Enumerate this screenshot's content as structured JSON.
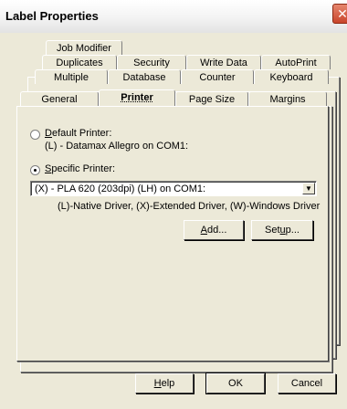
{
  "window": {
    "title": "Label Properties",
    "close_glyph": "✕"
  },
  "tabs": {
    "row1": [
      "Job Modifier"
    ],
    "row2": [
      "Duplicates",
      "Security",
      "Write Data",
      "AutoPrint"
    ],
    "row3": [
      "Multiple",
      "Database",
      "Counter",
      "Keyboard"
    ],
    "row4": [
      "General",
      "Printer",
      "Page Size",
      "Margins"
    ],
    "active": "Printer"
  },
  "printer_panel": {
    "default_printer_label_prefix": "",
    "default_printer_label_u": "D",
    "default_printer_label_rest": "efault Printer:",
    "default_printer_value": "(L) - Datamax Allegro on COM1:",
    "specific_printer_label_u": "S",
    "specific_printer_label_rest": "pecific Printer:",
    "selected_printer": "(X) - PLA 620 (203dpi) (LH) on COM1:",
    "driver_legend": "(L)-Native Driver, (X)-Extended Driver, (W)-Windows Driver",
    "add_button_u": "A",
    "add_button_rest": "dd...",
    "setup_button_prefix": "Set",
    "setup_button_u": "u",
    "setup_button_rest": "p..."
  },
  "footer": {
    "help_u": "H",
    "help_rest": "elp",
    "ok_label": "OK",
    "cancel_label": "Cancel"
  },
  "radio_state": {
    "default_printer": false,
    "specific_printer": true
  },
  "colors": {
    "dialog_bg": "#ece9d8",
    "close_button": "#c9452b"
  }
}
